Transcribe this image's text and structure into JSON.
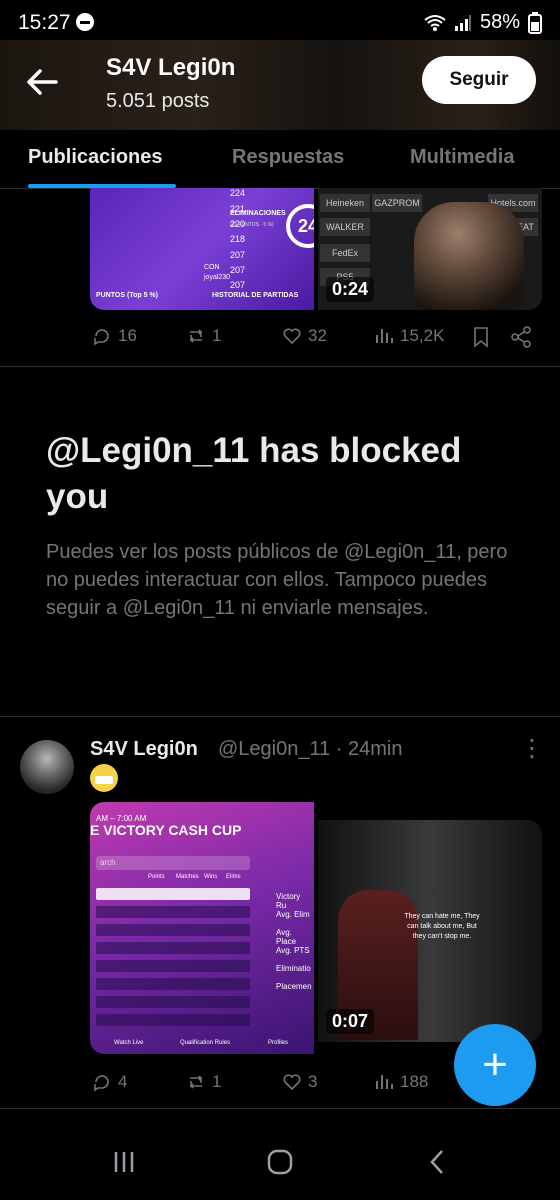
{
  "status_bar": {
    "time": "15:27",
    "battery": "58%"
  },
  "profile": {
    "name": "S4V Legi0n",
    "posts_count": "5.051 posts",
    "follow_label": "Seguir"
  },
  "tabs": [
    {
      "label": "Publicaciones",
      "active": true
    },
    {
      "label": "Respuestas",
      "active": false
    },
    {
      "label": "Multimedia",
      "active": false
    }
  ],
  "post1": {
    "media_left": {
      "eliminations_label": "ELIMINACIONES",
      "eliminations_sub": "(11 PUNTOS · 5 %)",
      "eliminations_value": "24",
      "con_label": "CON",
      "con_user": "joyal230",
      "history_label": "HISTORIAL DE PARTIDAS",
      "points_label": "PUNTOS (Top 5 %)",
      "rows": [
        "224",
        "221",
        "220",
        "218",
        "207",
        "207",
        "207"
      ]
    },
    "media_right": {
      "duration": "0:24",
      "sponsors": [
        "Heineken",
        "Hotels.com",
        "GAZPROM",
        "WALKER",
        "FedEx",
        "PS5",
        "JUST EAT"
      ]
    },
    "actions": {
      "replies": "16",
      "reposts": "1",
      "likes": "32",
      "views": "15,2K"
    }
  },
  "blocked": {
    "title": "@Legi0n_11 has blocked you",
    "description": "Puedes ver los posts públicos de @Legi0n_11, pero no puedes interactuar con ellos. Tampoco puedes seguir a @Legi0n_11 ni enviarle mensajes."
  },
  "post2": {
    "author_name": "S4V Legi0n",
    "handle": "@Legi0n_11",
    "time": "· 24min",
    "media_left": {
      "time_label": "AM – 7:00 AM",
      "title": "E VICTORY CASH CUP",
      "search_placeholder": "arch",
      "columns": [
        "Points",
        "Matches",
        "Wins",
        "Elims"
      ],
      "side_labels": [
        "Victory Ru",
        "Avg. Elim",
        "Avg. Place",
        "Avg. PTS",
        "Eliminatio",
        "Placemen"
      ],
      "bottom": [
        "Watch Live",
        "Qualification Rules",
        "Profiles"
      ]
    },
    "media_right": {
      "duration": "0:07",
      "quote": "They can hate me, They can talk about me, But they can't stop me."
    },
    "actions": {
      "replies": "4",
      "reposts": "1",
      "likes": "3",
      "views": "188"
    }
  },
  "icons": [
    "back-arrow-icon",
    "reply-icon",
    "repost-icon",
    "like-icon",
    "views-icon",
    "bookmark-icon",
    "share-icon",
    "more-icon",
    "plus-icon"
  ],
  "colors": {
    "accent": "#1d9bf0",
    "background": "#000000",
    "text": "#e7e9ea",
    "secondary": "#71767b"
  }
}
